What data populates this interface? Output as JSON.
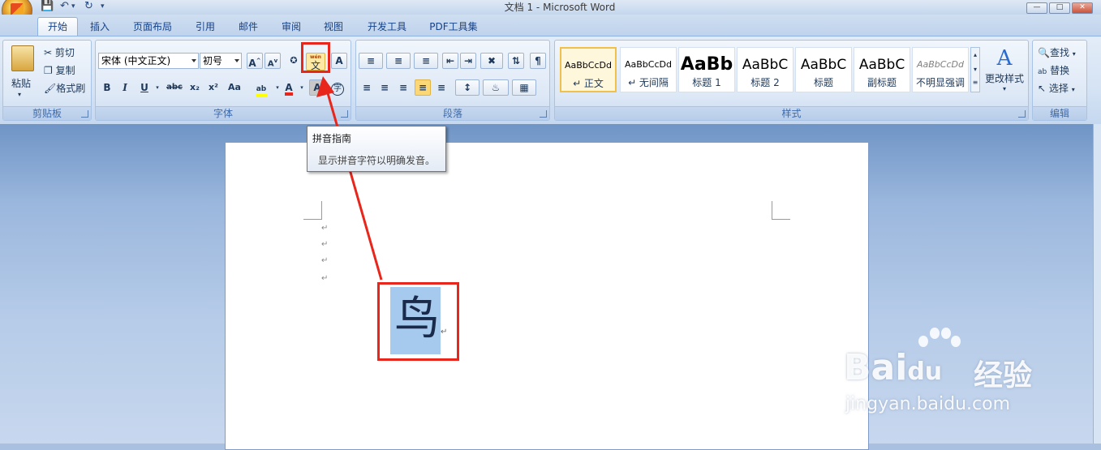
{
  "app": {
    "title": "文档 1 - Microsoft Word",
    "qat": {
      "save_icon": "save-icon",
      "undo_icon": "undo-icon",
      "redo_icon": "redo-icon"
    }
  },
  "tabs": [
    {
      "label": "开始",
      "active": true
    },
    {
      "label": "插入"
    },
    {
      "label": "页面布局"
    },
    {
      "label": "引用"
    },
    {
      "label": "邮件"
    },
    {
      "label": "审阅"
    },
    {
      "label": "视图"
    },
    {
      "label": "开发工具"
    },
    {
      "label": "PDF工具集"
    }
  ],
  "clipboard": {
    "group_label": "剪贴板",
    "paste": "粘贴",
    "cut": "剪切",
    "copy": "复制",
    "format_painter": "格式刷"
  },
  "font": {
    "group_label": "字体",
    "font_name": "宋体 (中文正文)",
    "font_size": "初号",
    "bold": "B",
    "italic": "I",
    "underline": "U",
    "strike": "abc",
    "subscript": "x₂",
    "superscript": "x²",
    "change_case": "Aa",
    "phonetic_top": "wén",
    "phonetic_char": "文",
    "char_border": "A",
    "enclose": "字"
  },
  "paragraph": {
    "group_label": "段落"
  },
  "styles": {
    "group_label": "样式",
    "items": [
      {
        "sample": "AaBbCcDd",
        "name": "↵ 正文",
        "selected": true
      },
      {
        "sample": "AaBbCcDd",
        "name": "↵ 无间隔"
      },
      {
        "sample": "AaBb",
        "name": "标题 1"
      },
      {
        "sample": "AaBbC",
        "name": "标题 2"
      },
      {
        "sample": "AaBbC",
        "name": "标题"
      },
      {
        "sample": "AaBbC",
        "name": "副标题"
      },
      {
        "sample": "AaBbCcDd",
        "name": "不明显强调"
      }
    ],
    "change_styles": "更改样式"
  },
  "editing": {
    "group_label": "编辑",
    "find": "查找",
    "replace": "替换",
    "select": "选择"
  },
  "tooltip": {
    "title": "拼音指南",
    "description": "显示拼音字符以明确发音。"
  },
  "document": {
    "paragraph_mark": "↵",
    "selected_char": "鸟"
  },
  "watermark": {
    "brand": "Bai",
    "brand2": "du",
    "suffix": "经验",
    "url": "jingyan.baidu.com"
  },
  "colors": {
    "highlight_red": "#e8261b",
    "selection": "#a6c9ee",
    "ribbon": "#dde8f6"
  }
}
